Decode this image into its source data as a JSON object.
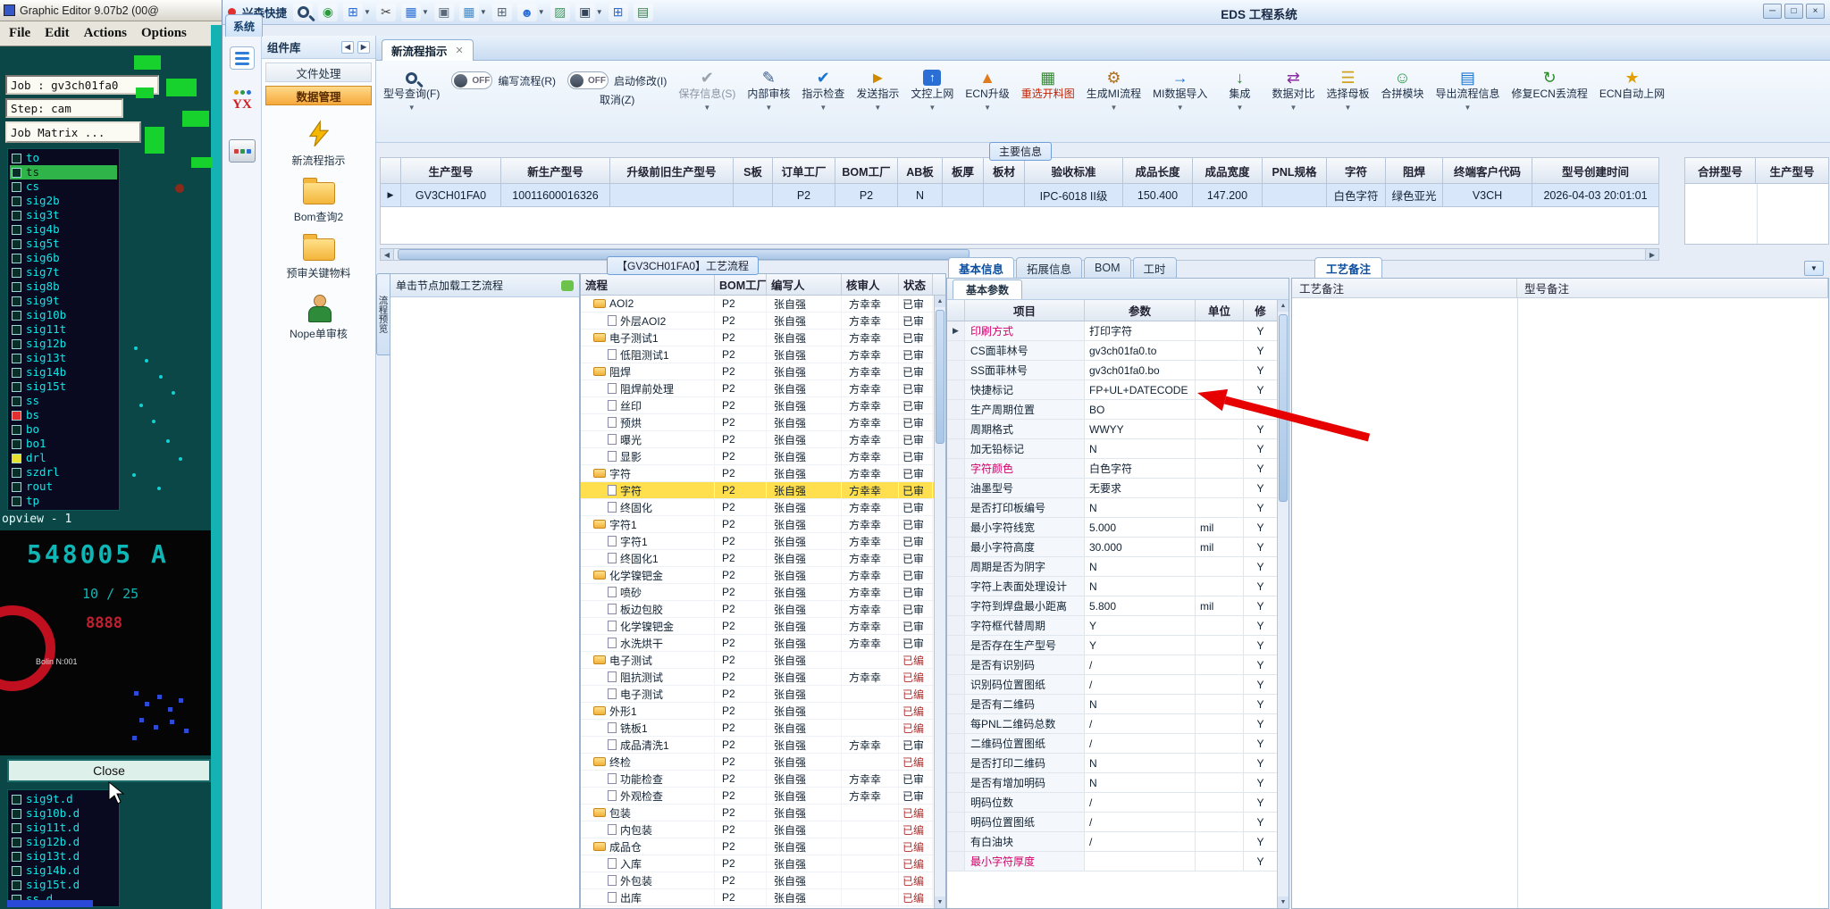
{
  "graphic_editor": {
    "title": "Graphic Editor 9.07b2 (00@",
    "menus": [
      "File",
      "Edit",
      "Actions",
      "Options"
    ],
    "job_field": "Job : gv3ch01fa0",
    "step_field": "Step: cam",
    "matrix_button": "Job Matrix ...",
    "layers": [
      {
        "name": "to",
        "chip": "dark"
      },
      {
        "name": "ts",
        "chip": "dark",
        "selected": true
      },
      {
        "name": "cs",
        "chip": "dark"
      },
      {
        "name": "sig2b",
        "chip": "dark"
      },
      {
        "name": "sig3t",
        "chip": "dark"
      },
      {
        "name": "sig4b",
        "chip": "dark"
      },
      {
        "name": "sig5t",
        "chip": "dark"
      },
      {
        "name": "sig6b",
        "chip": "dark"
      },
      {
        "name": "sig7t",
        "chip": "dark"
      },
      {
        "name": "sig8b",
        "chip": "dark"
      },
      {
        "name": "sig9t",
        "chip": "dark"
      },
      {
        "name": "sig10b",
        "chip": "dark"
      },
      {
        "name": "sig11t",
        "chip": "dark"
      },
      {
        "name": "sig12b",
        "chip": "dark"
      },
      {
        "name": "sig13t",
        "chip": "dark"
      },
      {
        "name": "sig14b",
        "chip": "dark"
      },
      {
        "name": "sig15t",
        "chip": "dark"
      },
      {
        "name": "ss",
        "chip": "dark"
      },
      {
        "name": "bs",
        "chip": "red"
      },
      {
        "name": "bo",
        "chip": "dark"
      },
      {
        "name": "bo1",
        "chip": "dark"
      },
      {
        "name": "drl",
        "chip": "yellow"
      },
      {
        "name": "szdrl",
        "chip": "dark"
      },
      {
        "name": "rout",
        "chip": "dark"
      },
      {
        "name": "tp",
        "chip": "dark"
      }
    ],
    "opview_label": "opview - 1",
    "photo": {
      "board_text": "548005 A",
      "line2": "10 / 25",
      "line3": "8888",
      "small_text": "Bolin N:001"
    },
    "close_button": "Close",
    "bottom_layers": [
      "sig9t.d",
      "sig10b.d",
      "sig11t.d",
      "sig12b.d",
      "sig13t.d",
      "sig14b.d",
      "sig15t.d",
      "ss.d"
    ]
  },
  "eds": {
    "window_title": "EDS 工程系统",
    "quick_access_label": "兴森快捷",
    "system_tab": "系统",
    "window_buttons": [
      "─",
      "□",
      "×"
    ],
    "topbar_icons": [
      "search-icon",
      "globe-icon",
      "table-icon",
      "scissors-icon",
      "sheet-icon",
      "copy-icon",
      "grid-icon",
      "apps-icon",
      "user-icon",
      "image-icon",
      "monitor-icon",
      "windows-icon",
      "notebook-icon"
    ],
    "component_panel": {
      "title": "组件库",
      "groups": [
        {
          "label": "文件处理",
          "active": false
        },
        {
          "label": "数据管理",
          "active": true
        }
      ],
      "tools": [
        {
          "label": "新流程指示",
          "icon": "lightning-icon"
        },
        {
          "label": "Bom查询2",
          "icon": "folder-icon"
        },
        {
          "label": "预审关键物料",
          "icon": "folder-icon"
        },
        {
          "label": "Nope单审核",
          "icon": "person-icon"
        }
      ]
    },
    "document_tab": "新流程指示",
    "ribbon": [
      {
        "label": "型号查询(F)",
        "icon": "search",
        "arrow": true
      },
      {
        "label": "编写流程(R)",
        "toggle": "OFF"
      },
      {
        "label": "启动修改(I)",
        "toggle": "OFF",
        "sub": "取消(Z)"
      },
      {
        "label": "保存信息(S)",
        "icon": "check-gray",
        "arrow": true,
        "disabled": true
      },
      {
        "label": "内部审核",
        "icon": "pencil",
        "arrow": true
      },
      {
        "label": "指示检查",
        "icon": "check-blue",
        "arrow": true
      },
      {
        "label": "发送指示",
        "icon": "send",
        "arrow": true
      },
      {
        "label": "文控上网",
        "icon": "upload",
        "arrow": true
      },
      {
        "label": "ECN升级",
        "icon": "up-orange",
        "arrow": true
      },
      {
        "label": "重选开料图",
        "icon": "image",
        "red": true
      },
      {
        "label": "生成MI流程",
        "icon": "gear",
        "arrow": true
      },
      {
        "label": "MI数据导入",
        "icon": "import",
        "arrow": true
      },
      {
        "label": "集成",
        "icon": "down-green",
        "arrow": true
      },
      {
        "label": "数据对比",
        "icon": "compare",
        "arrow": true
      },
      {
        "label": "选择母板",
        "icon": "list",
        "arrow": true
      },
      {
        "label": "合拼模块",
        "icon": "smiley"
      },
      {
        "label": "导出流程信息",
        "icon": "export",
        "arrow": true
      },
      {
        "label": "修复ECN丢流程",
        "icon": "repair"
      },
      {
        "label": "ECN自动上网",
        "icon": "star"
      }
    ],
    "main_info": {
      "section_label": "主要信息",
      "headers": [
        "生产型号",
        "新生产型号",
        "升级前旧生产型号",
        "S板",
        "订单工厂",
        "BOM工厂",
        "AB板",
        "板厚",
        "板材",
        "验收标准",
        "成品长度",
        "成品宽度",
        "PNL规格",
        "字符",
        "阻焊",
        "终端客户代码",
        "型号创建时间"
      ],
      "row": [
        "GV3CH01FA0",
        "10011600016326",
        "",
        "",
        "P2",
        "P2",
        "N",
        "",
        "",
        "IPC-6018 II级",
        "150.400",
        "147.200",
        "",
        "白色字符",
        "绿色亚光",
        "V3CH",
        "2026-04-03 20:01:01"
      ],
      "extra_headers": [
        "合拼型号",
        "生产型号"
      ]
    },
    "process_flow": {
      "section_label": "【GV3CH01FA0】工艺流程",
      "side_tab": "流程预览",
      "hint": "单击节点加载工艺流程",
      "columns": [
        "流程",
        "BOM工厂",
        "编写人",
        "核审人",
        "状态"
      ],
      "rows": [
        {
          "name": "AOI2",
          "type": "folder",
          "bom": "P2",
          "writer": "张自强",
          "auditor": "方幸幸",
          "status": "已审"
        },
        {
          "name": "外层AOI2",
          "type": "leaf",
          "bom": "P2",
          "writer": "张自强",
          "auditor": "方幸幸",
          "status": "已审"
        },
        {
          "name": "电子测试1",
          "type": "folder",
          "bom": "P2",
          "writer": "张自强",
          "auditor": "方幸幸",
          "status": "已审"
        },
        {
          "name": "低阻测试1",
          "type": "leaf",
          "bom": "P2",
          "writer": "张自强",
          "auditor": "方幸幸",
          "status": "已审"
        },
        {
          "name": "阻焊",
          "type": "folder",
          "bom": "P2",
          "writer": "张自强",
          "auditor": "方幸幸",
          "status": "已审"
        },
        {
          "name": "阻焊前处理",
          "type": "leaf",
          "bom": "P2",
          "writer": "张自强",
          "auditor": "方幸幸",
          "status": "已审"
        },
        {
          "name": "丝印",
          "type": "leaf",
          "bom": "P2",
          "writer": "张自强",
          "auditor": "方幸幸",
          "status": "已审"
        },
        {
          "name": "预烘",
          "type": "leaf",
          "bom": "P2",
          "writer": "张自强",
          "auditor": "方幸幸",
          "status": "已审"
        },
        {
          "name": "曝光",
          "type": "leaf",
          "bom": "P2",
          "writer": "张自强",
          "auditor": "方幸幸",
          "status": "已审"
        },
        {
          "name": "显影",
          "type": "leaf",
          "bom": "P2",
          "writer": "张自强",
          "auditor": "方幸幸",
          "status": "已审"
        },
        {
          "name": "字符",
          "type": "folder",
          "bom": "P2",
          "writer": "张自强",
          "auditor": "方幸幸",
          "status": "已审"
        },
        {
          "name": "字符",
          "type": "leaf",
          "bom": "P2",
          "writer": "张自强",
          "auditor": "方幸幸",
          "status": "已审",
          "selected": true
        },
        {
          "name": "终固化",
          "type": "leaf",
          "bom": "P2",
          "writer": "张自强",
          "auditor": "方幸幸",
          "status": "已审"
        },
        {
          "name": "字符1",
          "type": "folder",
          "bom": "P2",
          "writer": "张自强",
          "auditor": "方幸幸",
          "status": "已审"
        },
        {
          "name": "字符1",
          "type": "leaf",
          "bom": "P2",
          "writer": "张自强",
          "auditor": "方幸幸",
          "status": "已审"
        },
        {
          "name": "终固化1",
          "type": "leaf",
          "bom": "P2",
          "writer": "张自强",
          "auditor": "方幸幸",
          "status": "已审"
        },
        {
          "name": "化学镍钯金",
          "type": "folder",
          "bom": "P2",
          "writer": "张自强",
          "auditor": "方幸幸",
          "status": "已审"
        },
        {
          "name": "喷砂",
          "type": "leaf",
          "bom": "P2",
          "writer": "张自强",
          "auditor": "方幸幸",
          "status": "已审"
        },
        {
          "name": "板边包胶",
          "type": "leaf",
          "bom": "P2",
          "writer": "张自强",
          "auditor": "方幸幸",
          "status": "已审"
        },
        {
          "name": "化学镍钯金",
          "type": "leaf",
          "bom": "P2",
          "writer": "张自强",
          "auditor": "方幸幸",
          "status": "已审"
        },
        {
          "name": "水洗烘干",
          "type": "leaf",
          "bom": "P2",
          "writer": "张自强",
          "auditor": "方幸幸",
          "status": "已审"
        },
        {
          "name": "电子测试",
          "type": "folder",
          "bom": "P2",
          "writer": "张自强",
          "auditor": "",
          "status": "已编"
        },
        {
          "name": "阻抗测试",
          "type": "leaf",
          "bom": "P2",
          "writer": "张自强",
          "auditor": "方幸幸",
          "status": "已编"
        },
        {
          "name": "电子测试",
          "type": "leaf",
          "bom": "P2",
          "writer": "张自强",
          "auditor": "",
          "status": "已编"
        },
        {
          "name": "外形1",
          "type": "folder",
          "bom": "P2",
          "writer": "张自强",
          "auditor": "",
          "status": "已编"
        },
        {
          "name": "铣板1",
          "type": "leaf",
          "bom": "P2",
          "writer": "张自强",
          "auditor": "",
          "status": "已编"
        },
        {
          "name": "成品清洗1",
          "type": "leaf",
          "bom": "P2",
          "writer": "张自强",
          "auditor": "方幸幸",
          "status": "已审"
        },
        {
          "name": "终检",
          "type": "folder",
          "bom": "P2",
          "writer": "张自强",
          "auditor": "",
          "status": "已编"
        },
        {
          "name": "功能检查",
          "type": "leaf",
          "bom": "P2",
          "writer": "张自强",
          "auditor": "方幸幸",
          "status": "已审"
        },
        {
          "name": "外观检查",
          "type": "leaf",
          "bom": "P2",
          "writer": "张自强",
          "auditor": "方幸幸",
          "status": "已审"
        },
        {
          "name": "包装",
          "type": "folder",
          "bom": "P2",
          "writer": "张自强",
          "auditor": "",
          "status": "已编"
        },
        {
          "name": "内包装",
          "type": "leaf",
          "bom": "P2",
          "writer": "张自强",
          "auditor": "",
          "status": "已编"
        },
        {
          "name": "成品仓",
          "type": "folder",
          "bom": "P2",
          "writer": "张自强",
          "auditor": "",
          "status": "已编"
        },
        {
          "name": "入库",
          "type": "leaf",
          "bom": "P2",
          "writer": "张自强",
          "auditor": "",
          "status": "已编"
        },
        {
          "name": "外包装",
          "type": "leaf",
          "bom": "P2",
          "writer": "张自强",
          "auditor": "",
          "status": "已编"
        },
        {
          "name": "出库",
          "type": "leaf",
          "bom": "P2",
          "writer": "张自强",
          "auditor": "",
          "status": "已编"
        }
      ]
    },
    "detail": {
      "tabs": [
        "基本信息",
        "拓展信息",
        "BOM",
        "工时"
      ],
      "active_tab": "基本信息",
      "param_tab": "基本参数",
      "columns": [
        "项目",
        "参数",
        "单位",
        "修"
      ],
      "params": [
        {
          "item": "印刷方式",
          "value": "打印字符",
          "unit": "",
          "mod": "Y",
          "hl": true
        },
        {
          "item": "CS面菲林号",
          "value": "gv3ch01fa0.to",
          "unit": "",
          "mod": "Y"
        },
        {
          "item": "SS面菲林号",
          "value": "gv3ch01fa0.bo",
          "unit": "",
          "mod": "Y"
        },
        {
          "item": "快捷标记",
          "value": "FP+UL+DATECODE",
          "unit": "",
          "mod": "Y"
        },
        {
          "item": "生产周期位置",
          "value": "BO",
          "unit": "",
          "mod": "Y"
        },
        {
          "item": "周期格式",
          "value": "WWYY",
          "unit": "",
          "mod": "Y"
        },
        {
          "item": "加无铅标记",
          "value": "N",
          "unit": "",
          "mod": "Y"
        },
        {
          "item": "字符颜色",
          "value": "白色字符",
          "unit": "",
          "mod": "Y",
          "hl": true
        },
        {
          "item": "油墨型号",
          "value": "无要求",
          "unit": "",
          "mod": "Y"
        },
        {
          "item": "是否打印板编号",
          "value": "N",
          "unit": "",
          "mod": "Y"
        },
        {
          "item": "最小字符线宽",
          "value": "5.000",
          "unit": "mil",
          "mod": "Y"
        },
        {
          "item": "最小字符高度",
          "value": "30.000",
          "unit": "mil",
          "mod": "Y"
        },
        {
          "item": "周期是否为阴字",
          "value": "N",
          "unit": "",
          "mod": "Y"
        },
        {
          "item": "字符上表面处理设计",
          "value": "N",
          "unit": "",
          "mod": "Y"
        },
        {
          "item": "字符到焊盘最小距离",
          "value": "5.800",
          "unit": "mil",
          "mod": "Y"
        },
        {
          "item": "字符框代替周期",
          "value": "Y",
          "unit": "",
          "mod": "Y"
        },
        {
          "item": "是否存在生产型号",
          "value": "Y",
          "unit": "",
          "mod": "Y"
        },
        {
          "item": "是否有识别码",
          "value": "/",
          "unit": "",
          "mod": "Y"
        },
        {
          "item": "识别码位置图纸",
          "value": "/",
          "unit": "",
          "mod": "Y"
        },
        {
          "item": "是否有二维码",
          "value": "N",
          "unit": "",
          "mod": "Y"
        },
        {
          "item": "每PNL二维码总数",
          "value": "/",
          "unit": "",
          "mod": "Y"
        },
        {
          "item": "二维码位置图纸",
          "value": "/",
          "unit": "",
          "mod": "Y"
        },
        {
          "item": "是否打印二维码",
          "value": "N",
          "unit": "",
          "mod": "Y"
        },
        {
          "item": "是否有增加明码",
          "value": "N",
          "unit": "",
          "mod": "Y"
        },
        {
          "item": "明码位数",
          "value": "/",
          "unit": "",
          "mod": "Y"
        },
        {
          "item": "明码位置图纸",
          "value": "/",
          "unit": "",
          "mod": "Y"
        },
        {
          "item": "有白油块",
          "value": "/",
          "unit": "",
          "mod": "Y"
        },
        {
          "item": "最小字符厚度",
          "value": "",
          "unit": "",
          "mod": "Y",
          "hl": true
        }
      ]
    },
    "notes": {
      "tab_label": "工艺备注",
      "columns": [
        "工艺备注",
        "型号备注"
      ]
    }
  }
}
